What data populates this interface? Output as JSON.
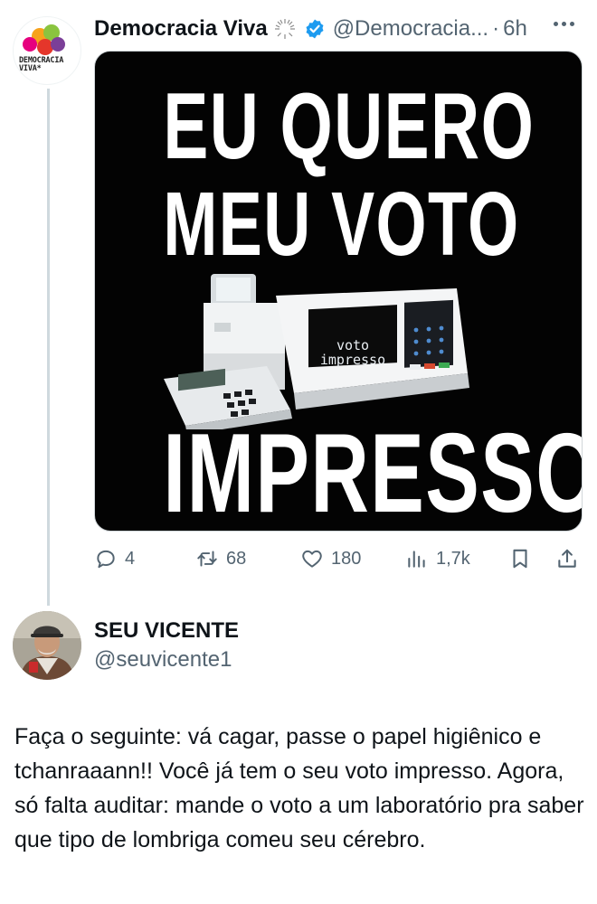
{
  "tweet": {
    "author_name": "Democracia Viva",
    "handle": "@Democracia...",
    "separator": "·",
    "time": "6h",
    "avatar_logo_text": "DEMOCRACIA VIVA*",
    "media": {
      "line1": "EU QUERO",
      "line2": "MEU VOTO",
      "line3": "IMPRESSO",
      "screen_text": "voto impresso",
      "screen_line1": "voto",
      "screen_line2": "impresso"
    },
    "actions": {
      "replies": "4",
      "retweets": "68",
      "likes": "180",
      "views": "1,7k"
    }
  },
  "reply": {
    "author_name": "SEU VICENTE",
    "handle": "@seuvicente1",
    "text": "Faça o seguinte: vá cagar, passe o papel higiênico e tchanraaann!! Você já tem o seu voto impresso. Agora, só falta auditar: mande o voto a um laboratório pra saber que tipo de lombriga comeu seu cérebro."
  },
  "colors": {
    "verified_blue": "#1d9bf0",
    "muted_text": "#536471",
    "primary_text": "#0f1419"
  },
  "icons": [
    "reply-icon",
    "retweet-icon",
    "like-icon",
    "views-icon",
    "bookmark-icon",
    "share-icon",
    "verified-badge-icon",
    "more-icon"
  ]
}
